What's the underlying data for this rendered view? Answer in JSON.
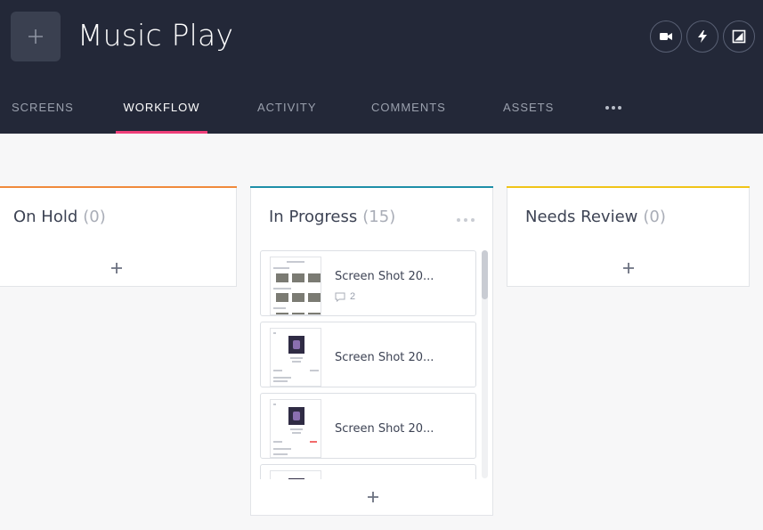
{
  "header": {
    "project_title": "Music Play",
    "buttons": [
      {
        "name": "video-icon"
      },
      {
        "name": "lightning-icon"
      },
      {
        "name": "edit-image-icon"
      }
    ]
  },
  "tabs": [
    {
      "label": "SCREENS",
      "active": false
    },
    {
      "label": "WORKFLOW",
      "active": true
    },
    {
      "label": "ACTIVITY",
      "active": false
    },
    {
      "label": "COMMENTS",
      "active": false
    },
    {
      "label": "ASSETS",
      "active": false
    }
  ],
  "columns": [
    {
      "title": "On Hold",
      "count": "(0)",
      "color": "#f08a3c"
    },
    {
      "title": "In Progress",
      "count": "(15)",
      "color": "#1f8fa8",
      "cards": [
        {
          "name": "Screen Shot 20...",
          "comments": "2"
        },
        {
          "name": "Screen Shot 20..."
        },
        {
          "name": "Screen Shot 20..."
        },
        {
          "name": ""
        }
      ]
    },
    {
      "title": "Needs Review",
      "count": "(0)",
      "color": "#f0c419"
    }
  ],
  "colors": {
    "header_bg": "#232838",
    "active_tab_underline": "#ef3f7a",
    "canvas_bg": "#f7f7f8"
  }
}
